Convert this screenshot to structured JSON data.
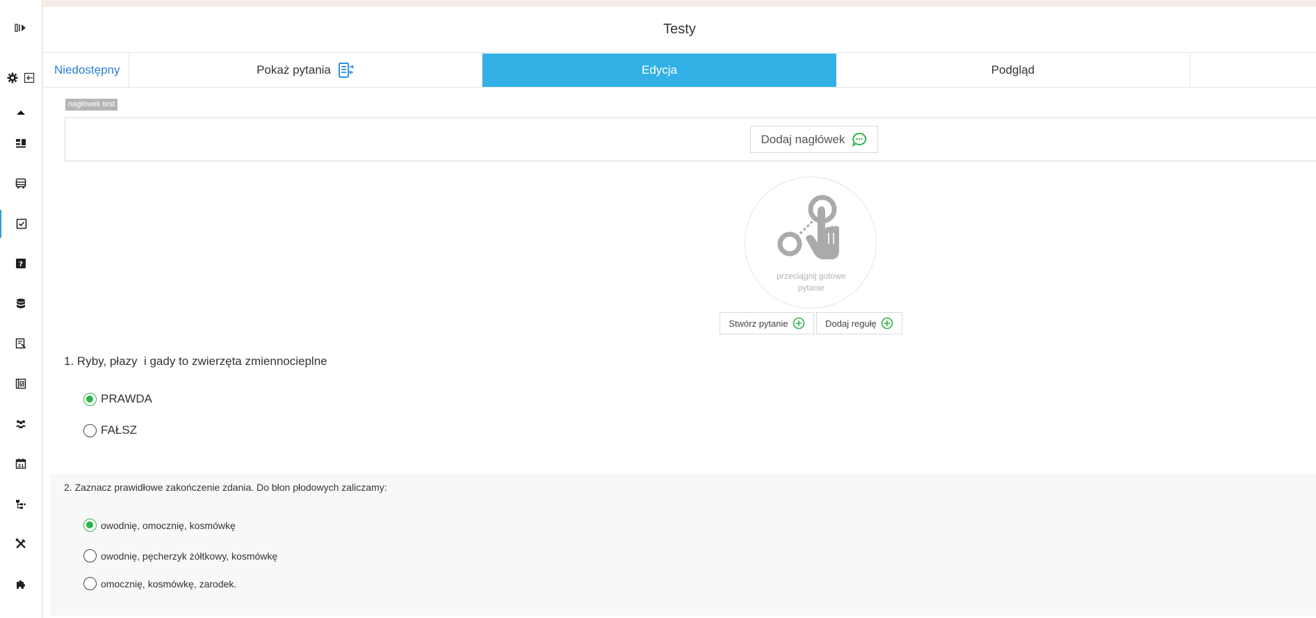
{
  "window": {
    "title": "Testy"
  },
  "tabs": {
    "status": "Niedostępny",
    "show_questions": "Pokaż pytania",
    "edit": "Edycja",
    "preview": "Podgląd"
  },
  "header_section": {
    "label": "nagłówek test",
    "add_header_button": "Dodaj nagłówek"
  },
  "drop_zone": {
    "line1": "przeciągnij gotowe",
    "line2": "pytanie"
  },
  "actions": {
    "create_question": "Stwórz pytanie",
    "add_rule": "Dodaj regułę"
  },
  "questions": [
    {
      "number": "1.",
      "text": "Ryby, płazy  i gady to zwierzęta zmiennocieplne",
      "options": [
        {
          "label": "PRAWDA",
          "checked": true
        },
        {
          "label": "FAŁSZ",
          "checked": false
        }
      ]
    },
    {
      "number": "2.",
      "text": "Zaznacz prawidłowe zakończenie zdania. Do błon płodowych zaliczamy:",
      "options": [
        {
          "label": "owodnię, omocznię, kosmówkę",
          "checked": true
        },
        {
          "label": "owodnię, pęcherzyk żółtkowy, kosmówkę",
          "checked": false
        },
        {
          "label": "omocznię, kosmówkę, zarodek.",
          "checked": false
        }
      ]
    }
  ],
  "sidebar": {
    "icons": [
      "collapse-icon",
      "settings-icon",
      "exit-icon",
      "caret-up-icon",
      "dashboard-icon",
      "bus-icon",
      "checkbox-icon",
      "help-icon",
      "database-icon",
      "report-icon",
      "checklist-icon",
      "group-icon",
      "calendar-icon",
      "hierarchy-icon",
      "tools-icon",
      "puzzle-icon"
    ]
  },
  "colors": {
    "accent": "#33b1e6",
    "status_link": "#2b7fd6",
    "checked_radio": "#2db34a",
    "add_icon": "#2db34a"
  }
}
